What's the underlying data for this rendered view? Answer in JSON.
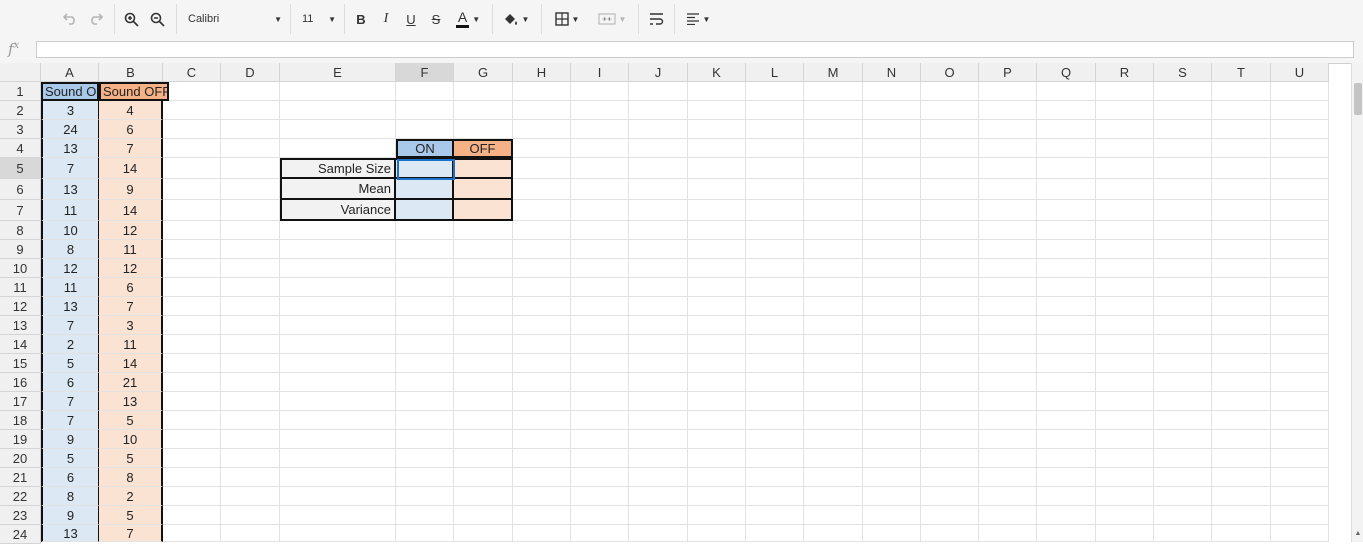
{
  "toolbar": {
    "font_name": "Calibri",
    "font_size": "11",
    "bold_label": "B",
    "italic_label": "I",
    "underline_label": "U",
    "strike_label": "S",
    "font_color_label": "A",
    "undo_icon": "undo-icon",
    "redo_icon": "redo-icon",
    "zoom_in_icon": "zoom-in-icon",
    "zoom_out_icon": "zoom-out-icon",
    "fill_icon": "fill-color-icon",
    "borders_icon": "borders-icon",
    "merge_icon": "merge-cells-icon",
    "wrap_icon": "wrap-text-icon",
    "align_icon": "align-icon"
  },
  "formula_bar": {
    "fx_label": "f",
    "fx_sup": "x",
    "value": ""
  },
  "columns": [
    "A",
    "B",
    "C",
    "D",
    "E",
    "F",
    "G",
    "H",
    "I",
    "J",
    "K",
    "L",
    "M",
    "N",
    "O",
    "P",
    "Q",
    "R",
    "S",
    "T",
    "U"
  ],
  "rows": [
    "1",
    "2",
    "3",
    "4",
    "5",
    "6",
    "7",
    "8",
    "9",
    "10",
    "11",
    "12",
    "13",
    "14",
    "15",
    "16",
    "17",
    "18",
    "19",
    "20",
    "21",
    "22",
    "23",
    "24"
  ],
  "selected_cell": "F5",
  "data": {
    "header_a": "Sound O",
    "header_b": "Sound OFF",
    "col_a": [
      "3",
      "24",
      "13",
      "7",
      "13",
      "11",
      "10",
      "8",
      "12",
      "11",
      "13",
      "7",
      "2",
      "5",
      "6",
      "7",
      "7",
      "9",
      "5",
      "6",
      "8",
      "9",
      "13"
    ],
    "col_b": [
      "4",
      "6",
      "7",
      "14",
      "9",
      "14",
      "12",
      "11",
      "12",
      "6",
      "7",
      "3",
      "11",
      "14",
      "21",
      "13",
      "5",
      "10",
      "5",
      "8",
      "2",
      "5",
      "7"
    ]
  },
  "summary": {
    "on_label": "ON",
    "off_label": "OFF",
    "rows": [
      "Sample Size",
      "Mean",
      "Variance"
    ]
  },
  "colors": {
    "on_header": "#a9c9ea",
    "off_header": "#f5b287",
    "on_fill": "#dce9f5",
    "off_fill": "#fbe3d3",
    "selection": "#1a73c8"
  }
}
